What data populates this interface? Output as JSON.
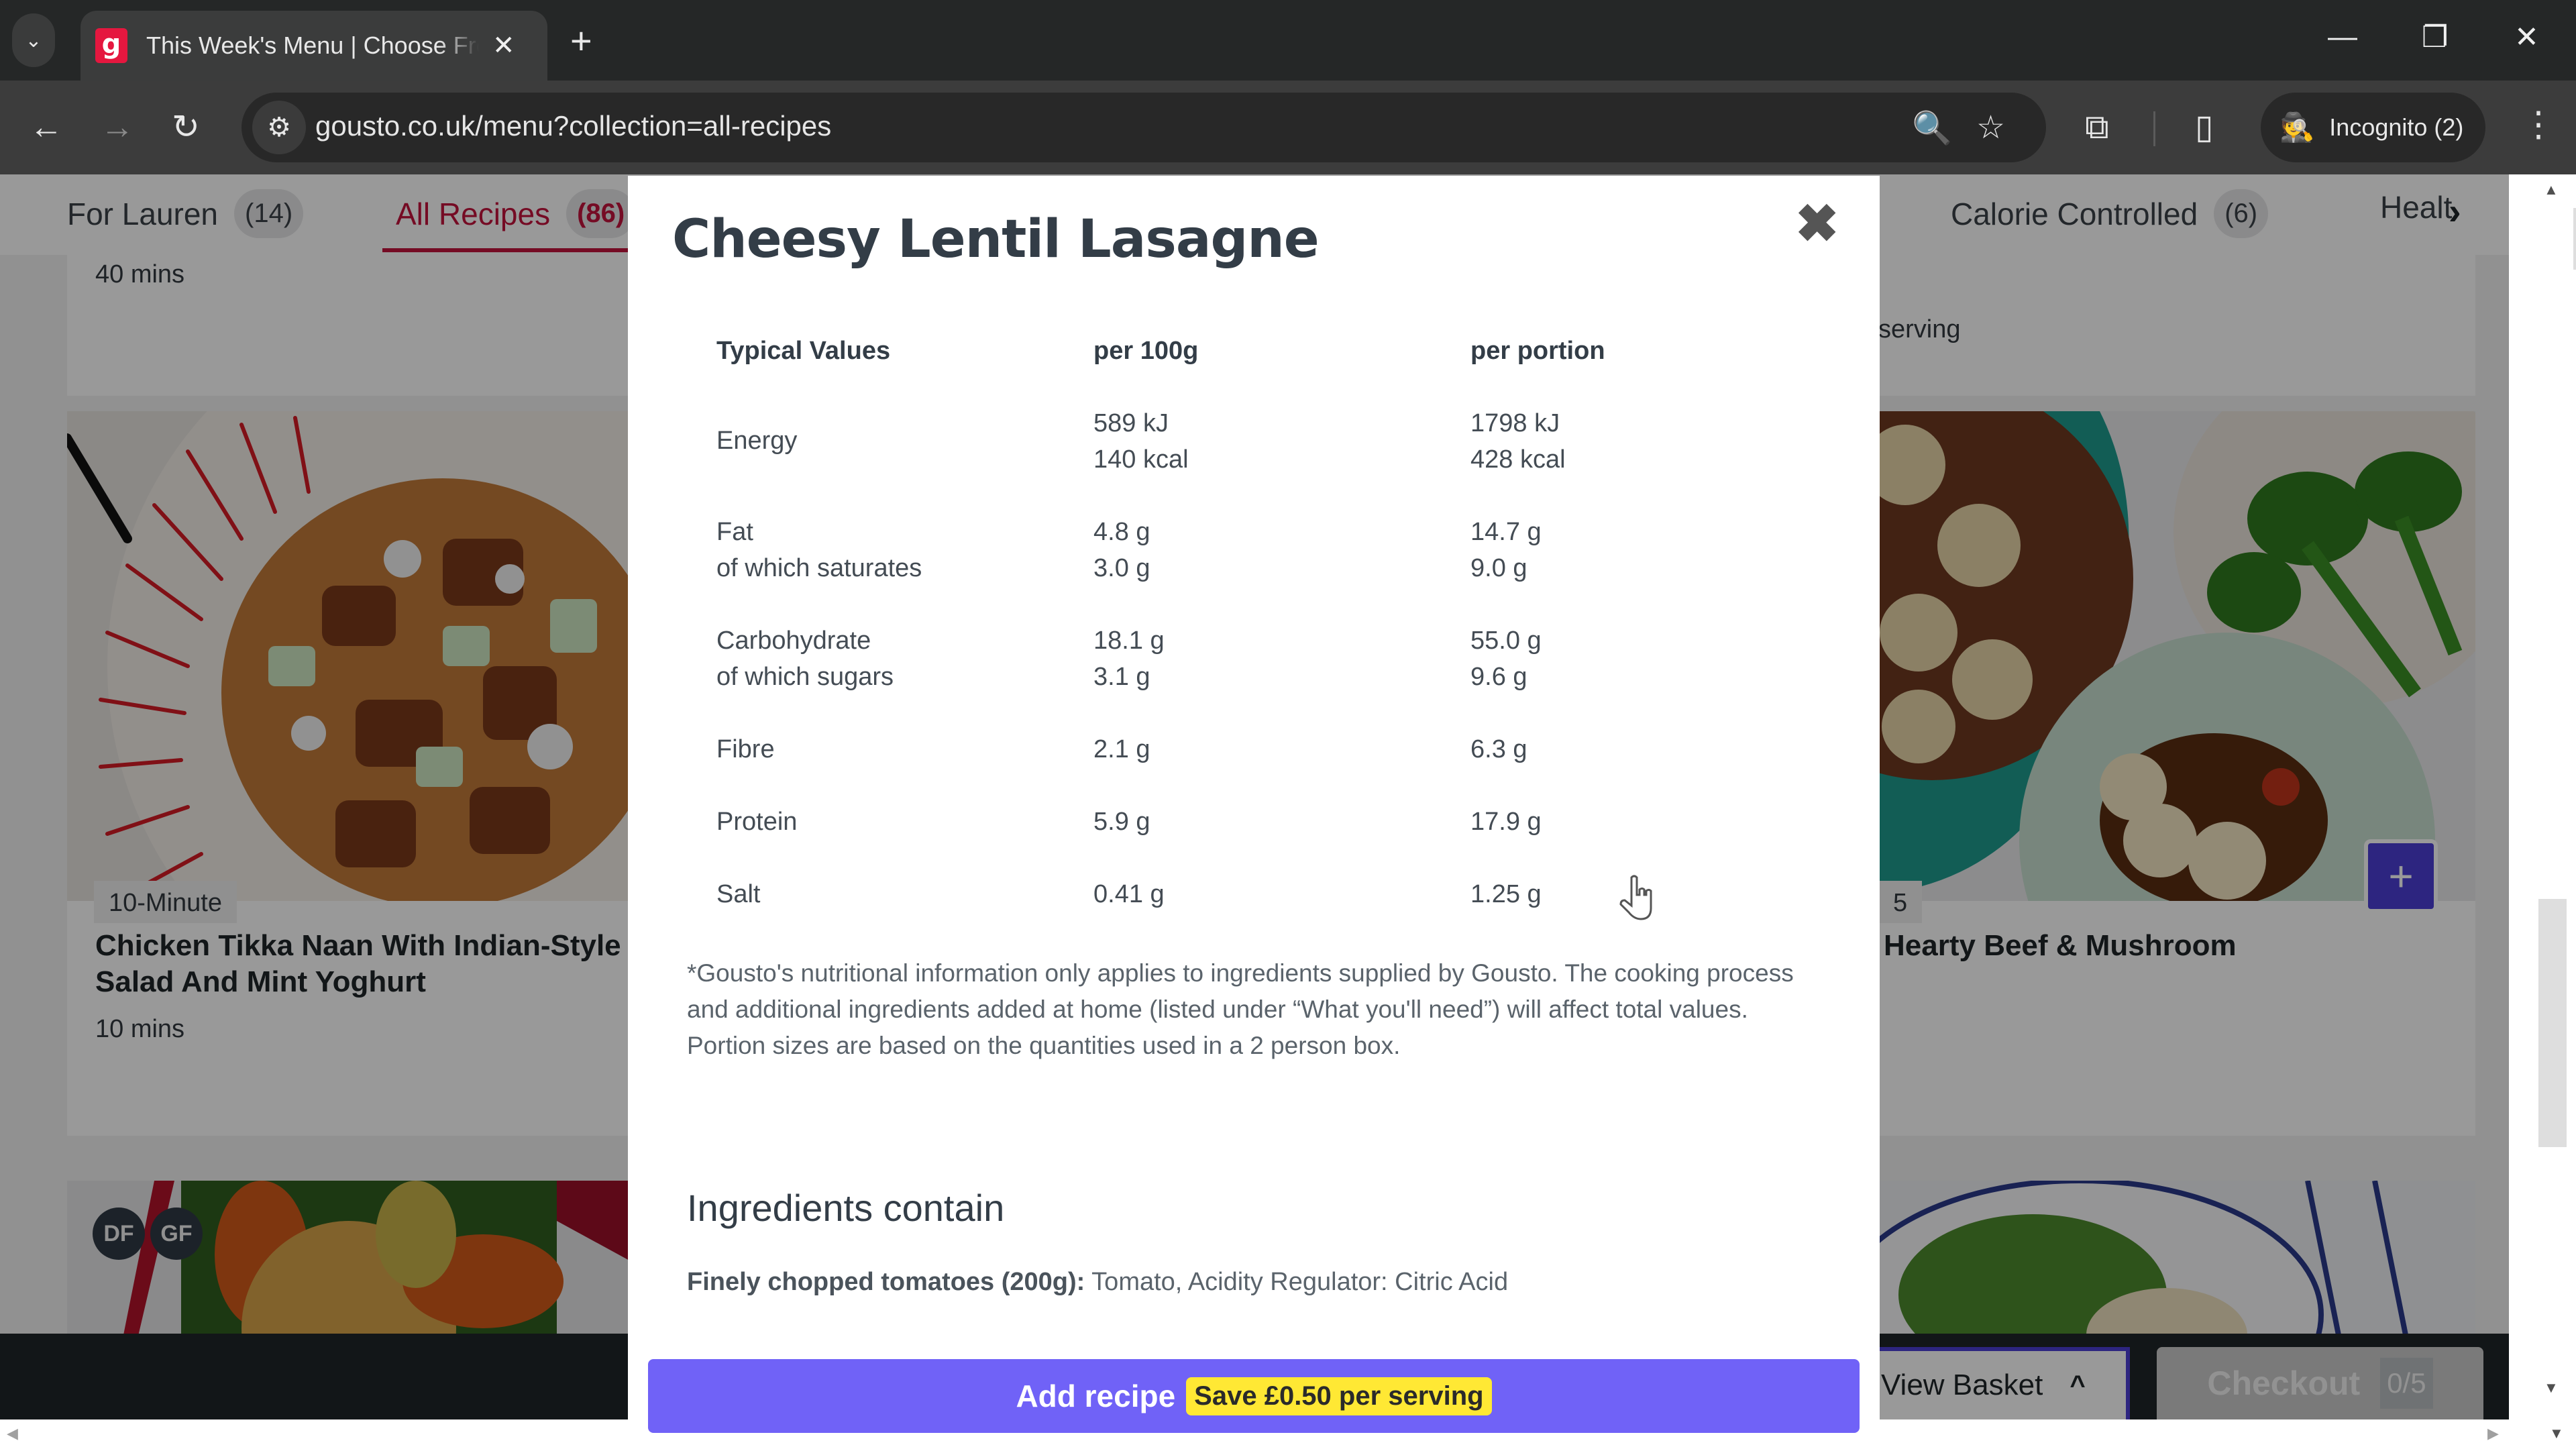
{
  "browser": {
    "tab_title": "This Week's Menu | Choose From",
    "favicon_letter": "g",
    "url": "gousto.co.uk/menu?collection=all-recipes",
    "incognito_label": "Incognito (2)",
    "icons": {
      "tab_list": "⌄",
      "tab_close": "✕",
      "new_tab": "+",
      "minimize": "—",
      "restore": "❐",
      "close": "✕",
      "back": "←",
      "forward": "→",
      "reload": "↻",
      "site_info": "⚙",
      "zoom": "🔍",
      "bookmark": "☆",
      "extensions": "⧉",
      "side_panel": "▯",
      "incognito": "🕵",
      "menu": "⋮"
    }
  },
  "collections": {
    "tabs": [
      {
        "label": "For Lauren",
        "count": "(14)",
        "active": false
      },
      {
        "label": "All Recipes",
        "count": "(86)",
        "active": true
      },
      {
        "label": "Calorie Controlled",
        "count": "(6)",
        "active": false
      },
      {
        "label": "Healt",
        "count": "",
        "active": false
      }
    ],
    "next_icon": "›"
  },
  "page": {
    "top_left_meta": "40 mins",
    "top_right_meta": "serving",
    "cards": [
      {
        "badge": "10-Minute",
        "title_line1": "Chicken Tikka Naan With Indian-Style",
        "title_line2": "Salad And Mint Yoghurt",
        "meta": "10 mins"
      },
      {
        "badge": "5",
        "title_line1": "Hearty Beef & Mushroom",
        "title_line2": "",
        "meta": "",
        "add_icon": "+"
      }
    ],
    "diet_badges": [
      "DF",
      "GF"
    ],
    "basket": {
      "view_basket": "View Basket",
      "view_basket_icon": "^",
      "checkout": "Checkout",
      "checkout_count": "0/5"
    }
  },
  "modal": {
    "title": "Cheesy Lentil Lasagne",
    "close_icon": "✖",
    "nutrition": {
      "headers": [
        "Typical Values",
        "per 100g",
        "per portion"
      ],
      "rows": [
        {
          "label": [
            "Energy"
          ],
          "per100g": [
            "589 kJ",
            "140 kcal"
          ],
          "perPortion": [
            "1798 kJ",
            "428 kcal"
          ]
        },
        {
          "label": [
            "Fat",
            "of which saturates"
          ],
          "per100g": [
            "4.8 g",
            "3.0 g"
          ],
          "perPortion": [
            "14.7 g",
            "9.0 g"
          ]
        },
        {
          "label": [
            "Carbohydrate",
            "of which sugars"
          ],
          "per100g": [
            "18.1 g",
            "3.1 g"
          ],
          "perPortion": [
            "55.0 g",
            "9.6 g"
          ]
        },
        {
          "label": [
            "Fibre"
          ],
          "per100g": [
            "2.1 g"
          ],
          "perPortion": [
            "6.3 g"
          ]
        },
        {
          "label": [
            "Protein"
          ],
          "per100g": [
            "5.9 g"
          ],
          "perPortion": [
            "17.9 g"
          ]
        },
        {
          "label": [
            "Salt"
          ],
          "per100g": [
            "0.41 g"
          ],
          "perPortion": [
            "1.25 g"
          ]
        }
      ]
    },
    "disclaimer_1": "*Gousto's nutritional information only applies to ingredients supplied by Gousto. The cooking process and additional ingredients added at home (listed under “What you'll need”) will affect total values.",
    "disclaimer_2": "Portion sizes are based on the quantities used in a 2 person box.",
    "ingredients_heading": "Ingredients contain",
    "ingredient_name": "Finely chopped tomatoes (200g):",
    "ingredient_detail": " Tomato, Acidity Regulator: Citric Acid",
    "add_recipe_label": "Add recipe",
    "save_badge": "Save £0.50 per serving"
  },
  "colors": {
    "brand_red": "#c3133c",
    "add_button": "#7062f7",
    "save_badge": "#ffe834",
    "plus_button": "#4b3fd6"
  }
}
